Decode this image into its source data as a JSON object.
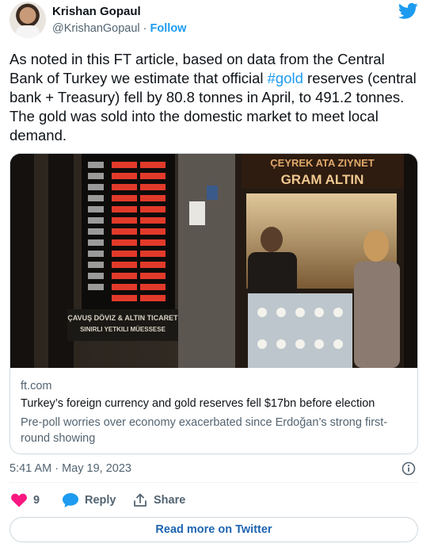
{
  "author": {
    "name": "Krishan Gopaul",
    "handle": "@KrishanGopaul",
    "separator": "·",
    "follow_label": "Follow"
  },
  "tweet": {
    "text_before": "As noted in this FT article, based on data from the Central Bank of Turkey we estimate that official ",
    "hashtag": "#gold",
    "text_after": " reserves (central bank + Treasury) fell by 80.8 tonnes in April, to 491.2 tonnes. The gold was sold into the domestic market to meet local demand."
  },
  "card": {
    "domain": "ft.com",
    "title": "Turkey’s foreign currency and gold reserves fell $17bn before election",
    "description": "Pre-poll worries over economy exacerbated since Erdoğan’s strong first-round showing",
    "image": {
      "sign_top": "ÇEYREK ATA ZIYNET",
      "sign_main": "GRAM ALTIN",
      "shop_sign_line1": "ÇAVUŞ DÖVIZ & ALTIN TICARET",
      "shop_sign_line2": "SINIRLI YETKILI MÜESSESE"
    }
  },
  "meta": {
    "timestamp": "5:41 AM · May 19, 2023"
  },
  "actions": {
    "like_count": "9",
    "reply_label": "Reply",
    "share_label": "Share",
    "read_more_label": "Read more on Twitter"
  },
  "colors": {
    "accent": "#1d9bf0",
    "like": "#f91880",
    "muted": "#536471"
  },
  "icons": {
    "logo": "twitter-bird-icon",
    "info": "info-circle-icon",
    "like": "heart-icon",
    "reply": "speech-bubble-icon",
    "share": "share-upload-icon"
  }
}
